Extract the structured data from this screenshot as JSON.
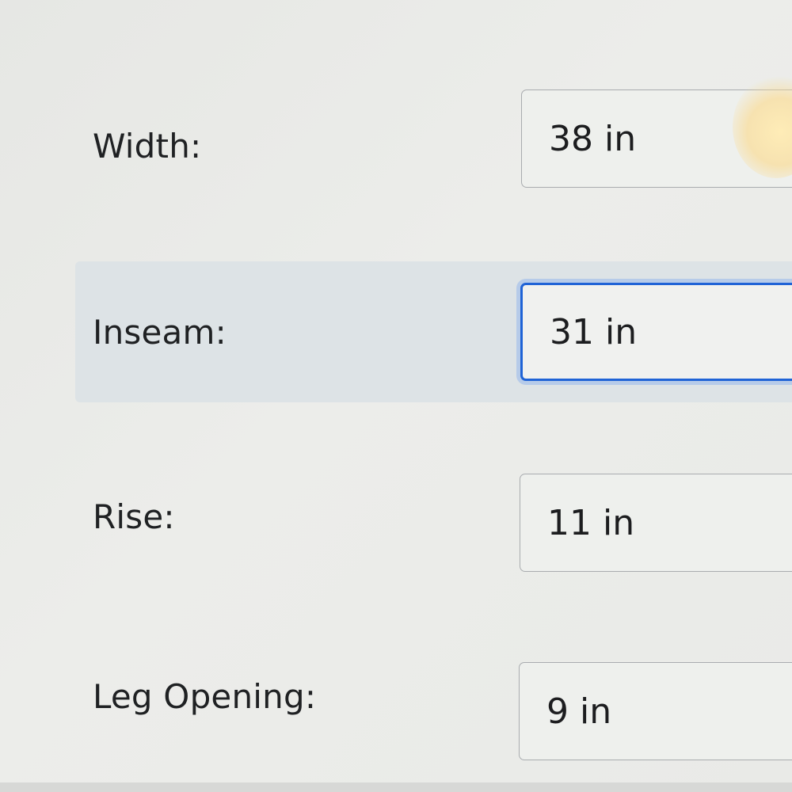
{
  "form": {
    "rows": [
      {
        "label": "Width:",
        "value": "38 in"
      },
      {
        "label": "Inseam:",
        "value": "31 in"
      },
      {
        "label": "Rise:",
        "value": "11 in"
      },
      {
        "label": "Leg Opening:",
        "value": "9 in"
      }
    ],
    "focused_row": "Inseam:",
    "focus_color": "#1f63d6"
  }
}
